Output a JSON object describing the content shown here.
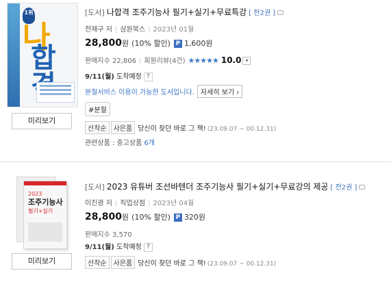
{
  "items": [
    {
      "category": "[도서]",
      "title": "나합격 조주기능사 필기+실기+무료특강",
      "edition": "[ 전2권 ]",
      "author": "전재구 저",
      "publisher": "삼원북스",
      "date": "2023년 01월",
      "price": "28,800",
      "currency": "원",
      "discount": "(10% 할인)",
      "point_badge": "P",
      "points": "1,600원",
      "sales_index": "판매지수 22,806",
      "review": "회원리뷰(4건)",
      "rating": 5,
      "rating_stars": "★★★★★",
      "score": "10.0",
      "dropdown_icon": "chevron-down-icon",
      "delivery_date": "9/11(월)",
      "delivery_label": "도착예정",
      "help": "?",
      "split_text": "분철서비스 이용이 가능한 도서입니다.",
      "detail_button": "자세히 보기",
      "detail_arrow": "›",
      "tag": "#분철",
      "chips": [
        "선착순",
        "사은품"
      ],
      "promo": "당신이 찾던 바로 그 책!",
      "promo_date": "(23.09.07 ~ 00.12.31)",
      "related_label": "관련상품 : 중고상품",
      "related_count": "6개",
      "preview_button": "미리보기",
      "cover_text": {
        "badge": "1위",
        "big": "나",
        "big2": "합격"
      }
    },
    {
      "category": "[도서]",
      "title": "2023 유튜버 조선바텐더 조주기능사 필기+실기+무료강의 제공",
      "edition": "[ 전2권 ]",
      "author": "이진광 저",
      "publisher": "직업상점",
      "date": "2023년 04월",
      "price": "28,800",
      "currency": "원",
      "discount": "(10% 할인)",
      "point_badge": "P",
      "points": "320원",
      "sales_index": "판매지수 3,570",
      "delivery_date": "9/11(월)",
      "delivery_label": "도착예정",
      "help": "?",
      "chips": [
        "선착순",
        "사은품"
      ],
      "promo": "당신이 찾던 바로 그 책!",
      "promo_date": "(23.09.07 ~ 00.12.31)",
      "preview_button": "미리보기",
      "cover_text": {
        "year": "2023",
        "title": "조주기능사",
        "sub": "필기+실기"
      }
    }
  ]
}
